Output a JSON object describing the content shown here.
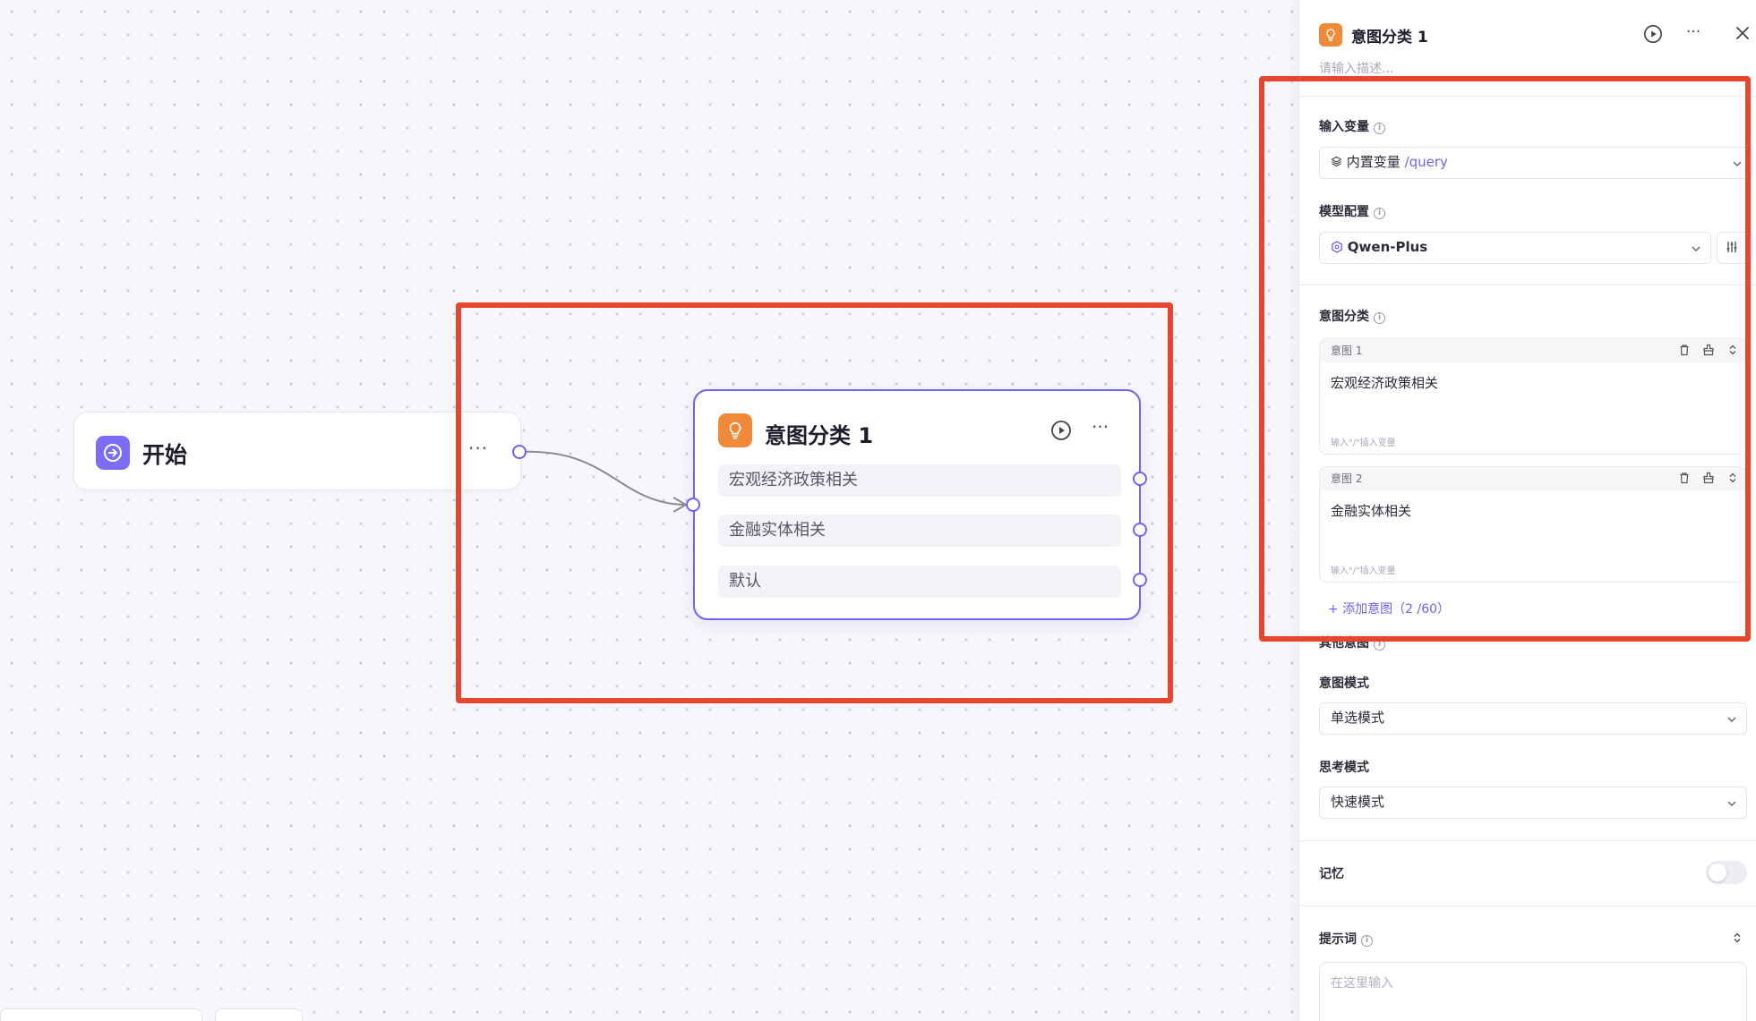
{
  "canvas": {
    "start_node": {
      "title": "开始",
      "more": "···"
    },
    "intent_node": {
      "title": "意图分类 1",
      "more": "···",
      "branches": [
        "宏观经济政策相关",
        "金融实体相关",
        "默认"
      ]
    }
  },
  "panel": {
    "title": "意图分类 1",
    "more": "···",
    "description_placeholder": "请输入描述...",
    "input_variable": {
      "label": "输入变量",
      "value_prefix": "内置变量",
      "value_path": "/query"
    },
    "model_config": {
      "label": "模型配置",
      "value": "Qwen-Plus"
    },
    "intent_classification": {
      "label": "意图分类",
      "intents": [
        {
          "name": "意图 1",
          "content": "宏观经济政策相关",
          "hint": "输入\"/\"插入变量"
        },
        {
          "name": "意图 2",
          "content": "金融实体相关",
          "hint": "输入\"/\"插入变量"
        }
      ],
      "add_label": "添加意图（2 /60）"
    },
    "other_intent_label": "其他意图",
    "intent_mode": {
      "label": "意图模式",
      "value": "单选模式"
    },
    "thinking_mode": {
      "label": "思考模式",
      "value": "快速模式"
    },
    "memory": {
      "label": "记忆",
      "enabled": false
    },
    "prompt": {
      "label": "提示词",
      "placeholder": "在这里输入"
    }
  },
  "colors": {
    "accent": "#6f63f0",
    "start_icon": "#7c6cf6",
    "intent_icon": "#f0893a",
    "highlight": "#e8452f"
  }
}
